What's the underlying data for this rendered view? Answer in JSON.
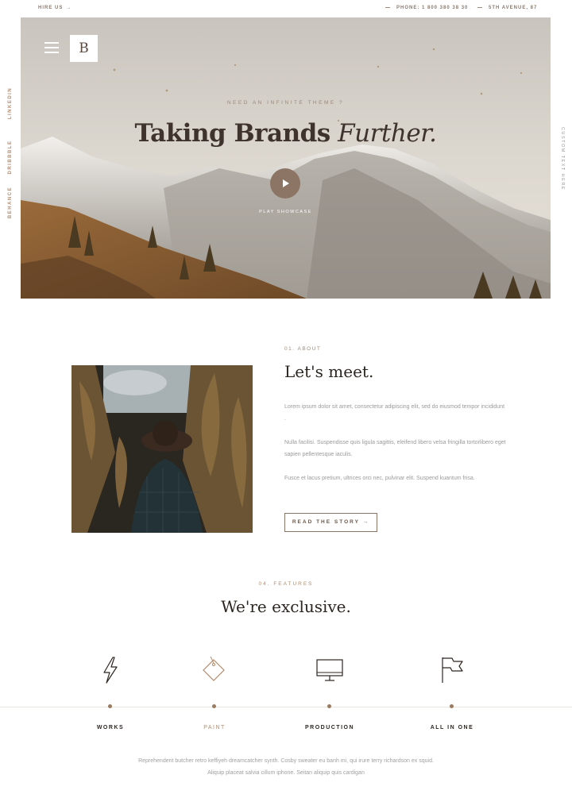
{
  "topbar": {
    "hire_label": "HIRE US",
    "hire_arrow": "→",
    "phone": "PHONE: 1 800 380 38 30",
    "address": "5TH AVENUE, 87"
  },
  "social": [
    "LINKEDIN",
    "DRIBBBLE",
    "BEHANCE"
  ],
  "side_right_text": "CUSTOM TEXT HERE",
  "hero": {
    "logo": "B",
    "kicker": "NEED AN INFINITE THEME ?",
    "title_a": "Taking Brands",
    "title_b": "Further.",
    "play_label": "PLAY SHOWCASE"
  },
  "about": {
    "num": "01. ABOUT",
    "title": "Let's meet.",
    "p1": "Lorem ipsum dolor sit amet, consectetur adipiscing elit, sed do eiusmod tempor incididunt .",
    "p2": "Nulla facilisi. Suspendisse quis ligula sagittis, eleifend libero velsa fringilla tortorlibero eget sapien pellentesque iaculis.",
    "p3": "Fusce et lacus pretium, ultrices orci nec, pulvinar elit. Suspend kuantum frisa.",
    "button": "READ THE STORY →"
  },
  "features": {
    "num": "04. FEATURES",
    "title": "We're exclusive.",
    "tabs": [
      {
        "label": "WORKS",
        "icon": "lightning-icon"
      },
      {
        "label": "PAINT",
        "icon": "paint-tag-icon"
      },
      {
        "label": "PRODUCTION",
        "icon": "monitor-icon"
      },
      {
        "label": "ALL IN ONE",
        "icon": "flag-icon"
      }
    ],
    "active_tab": "PAINT",
    "desc_line1": "Reprehenderit butcher retro keffiyeh dreamcatcher synth. Cosby sweater eu banh mi, qui irure terry richardson ex squid.",
    "desc_line2": "Aliquip placeat salvia cillum iphone. Seitan aliquip quis cardigan"
  },
  "colors": {
    "accent": "#b48c6e",
    "dark": "#2d2620",
    "button_border": "#8a7565"
  }
}
